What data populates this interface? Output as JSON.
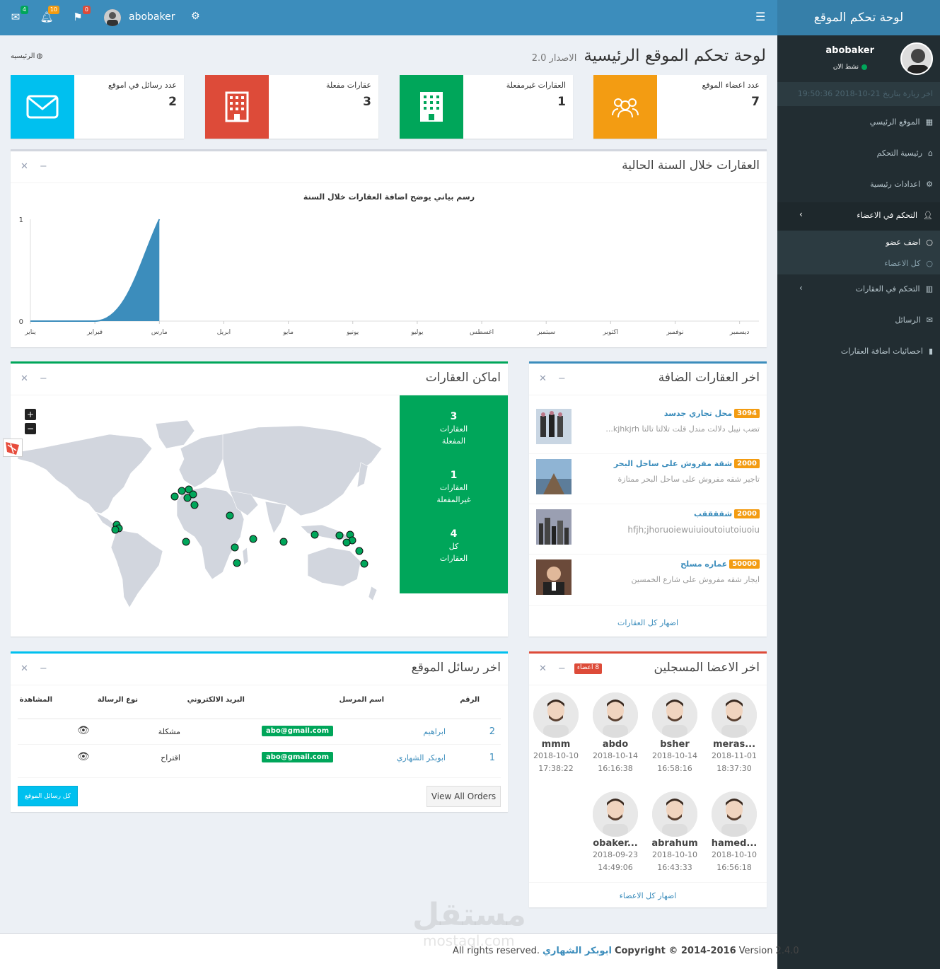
{
  "header": {
    "mail_count": "4",
    "notif_count": "10",
    "flag_count": "0",
    "username": "abobaker",
    "colors": {
      "bar": "#3c8dbc",
      "brand": "#367fa9"
    }
  },
  "sidebar": {
    "brand": "لوحة تحكم الموقع",
    "user_name": "abobaker",
    "status": "نشط الان",
    "last_visit": "اخر زيارة بتاريخ 21-10-2018 19:50:36",
    "items": [
      {
        "label": "الموقع الرئيسي",
        "icon": "grid-icon"
      },
      {
        "label": "رئيسية التحكم",
        "icon": "home-icon"
      },
      {
        "label": "اعدادات رئيسية",
        "icon": "gears-icon"
      },
      {
        "label": "التحكم في الاعضاء",
        "icon": "user-icon"
      },
      {
        "label": "التحكم في العقارات",
        "icon": "building-icon"
      },
      {
        "label": "الرسائل",
        "icon": "envelope-icon"
      },
      {
        "label": "احصائيات اضافة العقارات",
        "icon": "bar-chart-icon"
      }
    ],
    "sub_items": [
      {
        "label": "اضف عضو"
      },
      {
        "label": "كل الاعضاء"
      }
    ]
  },
  "page": {
    "title": "لوحة تحكم الموقع الرئيسية",
    "version": "الاصدار 2.0",
    "breadcrumb": "الرئيسيه"
  },
  "info_boxes": [
    {
      "label": "عدد اعضاء الموقع",
      "value": "7",
      "color": "#f39c12",
      "icon": "users-icon"
    },
    {
      "label": "العقارات غيرمفعلة",
      "value": "1",
      "color": "#00a65a",
      "icon": "building-icon"
    },
    {
      "label": "عقارات مفعلة",
      "value": "3",
      "color": "#dd4b39",
      "icon": "building-icon"
    },
    {
      "label": "عدد رسائل في اموقع",
      "value": "2",
      "color": "#00c0ef",
      "icon": "envelope-icon"
    }
  ],
  "chart_box": {
    "title": "العقارات خلال السنة الحالية",
    "chart_title": "رسم بياني يوضح اضافة العقارات خلال السنة"
  },
  "chart_data": {
    "type": "area",
    "title": "رسم بياني يوضح اضافة العقارات خلال السنة",
    "categories": [
      "يناير",
      "فبراير",
      "مارس",
      "ابريل",
      "مايو",
      "يونيو",
      "يوليو",
      "اغسطس",
      "سبتمبر",
      "اكتوبر",
      "نوفمبر",
      "ديسمبر"
    ],
    "values": [
      0,
      0,
      1,
      null,
      null,
      null,
      null,
      null,
      null,
      null,
      null,
      null
    ],
    "ylim": [
      0,
      1
    ],
    "yticks": [
      "0",
      "1"
    ],
    "color": "#3c8dbc"
  },
  "map_box": {
    "title": "اماكن العقارات",
    "zoom_in": "+",
    "zoom_out": "−",
    "stats": [
      {
        "num": "3",
        "l1": "العقارات",
        "l2": "المفعلة"
      },
      {
        "num": "1",
        "l1": "العقارات",
        "l2": "غيرالمفعلة"
      },
      {
        "num": "4",
        "l1": "كل",
        "l2": "العقارات"
      }
    ]
  },
  "latest_props": {
    "title": "اخر العقارات الضافة",
    "items": [
      {
        "price": "3094",
        "name": "محل تجاري جدسد",
        "desc": "تضب نيبل دلالت مندل قلت تلالتا تالتا kjhkjrh..."
      },
      {
        "price": "2000",
        "name": "شقة مفروش على ساحل البحر",
        "desc": "تاجير شقه مفروش على ساحل البحر ممتازة"
      },
      {
        "price": "2000",
        "name": "شققققب",
        "desc": "hfjh;jhoruoiewuiuioutoiutoiuoiu"
      },
      {
        "price": "50000",
        "name": "عماره مسلح",
        "desc": "ايجار شقه مفروش على شارع الخمسين"
      }
    ],
    "footer": "اضهار كل العقارات"
  },
  "messages_box": {
    "title": "اخر رسائل الموقع",
    "headers": [
      "الرقم",
      "اسم المرسل",
      "البريد الالكتروني",
      "نوع الرسالة",
      "المشاهدة"
    ],
    "rows": [
      {
        "id": "2",
        "sender": "ابراهيم",
        "email": "abo@gmail.com",
        "type": "مشكلة"
      },
      {
        "id": "1",
        "sender": "ابوبكر الشهاري",
        "email": "abo@gmail.com",
        "type": "اقتراح"
      }
    ],
    "btn_all": "كل رسائل الموقع",
    "btn_orders": "View All Orders"
  },
  "members_box": {
    "title": "اخر الاعضا المسجلين",
    "badge": "8 اعضاء",
    "users": [
      {
        "name": "meras...",
        "date": "2018-11-01",
        "time": "18:37:30"
      },
      {
        "name": "bsher",
        "date": "2018-10-14",
        "time": "16:58:16"
      },
      {
        "name": "abdo",
        "date": "2018-10-14",
        "time": "16:16:38"
      },
      {
        "name": "mmm",
        "date": "2018-10-10",
        "time": "17:38:22"
      },
      {
        "name": "hamed...",
        "date": "2018-10-10",
        "time": "16:56:18"
      },
      {
        "name": "abrahum",
        "date": "2018-10-10",
        "time": "16:43:33"
      },
      {
        "name": "obaker...",
        "date": "2018-09-23",
        "time": "14:49:06"
      }
    ],
    "footer": "اضهار كل الاعضاء"
  },
  "footer": {
    "version": "Version 2.4.0",
    "copyright": "Copyright © 2014-2016",
    "author": "ابوبكر الشهاري",
    "rights": "All rights reserved.",
    "watermark": "مستقل",
    "watermark_url": "mostaql.com"
  }
}
